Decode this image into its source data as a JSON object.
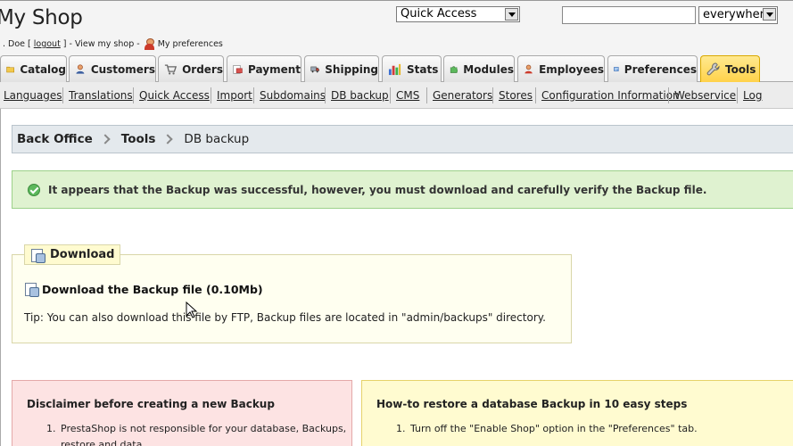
{
  "header": {
    "shop_title": "My Shop",
    "user_prefix": ". Doe [",
    "logout": "logout",
    "user_mid": "] - View my shop -",
    "preferences": "My preferences",
    "quick_access": "Quick Access",
    "search_value": "",
    "search_scope": "everywhere"
  },
  "tabs": [
    {
      "label": "Catalog",
      "icon": "folder-icon"
    },
    {
      "label": "Customers",
      "icon": "customers-icon"
    },
    {
      "label": "Orders",
      "icon": "cart-icon"
    },
    {
      "label": "Payment",
      "icon": "payment-icon"
    },
    {
      "label": "Shipping",
      "icon": "truck-icon"
    },
    {
      "label": "Stats",
      "icon": "chart-icon"
    },
    {
      "label": "Modules",
      "icon": "puzzle-icon"
    },
    {
      "label": "Employees",
      "icon": "employee-icon"
    },
    {
      "label": "Preferences",
      "icon": "preferences-icon"
    },
    {
      "label": "Tools",
      "icon": "wrench-icon",
      "active": true
    }
  ],
  "subtabs": [
    "Languages",
    "Translations",
    "Quick Access",
    "Import",
    "Subdomains",
    "DB backup",
    "CMS",
    "Generators",
    "Stores",
    "Configuration Information",
    "Webservice",
    "Log"
  ],
  "breadcrumb": [
    "Back Office",
    "Tools",
    "DB backup"
  ],
  "success_message": "It appears that the Backup was successful, however, you must download and carefully verify the Backup file.",
  "download": {
    "legend": "Download",
    "link": "Download the Backup file (0.10Mb)",
    "tip": "Tip: You can also download this file by FTP, Backup files are located in \"admin/backups\" directory."
  },
  "disclaimer": {
    "title": "Disclaimer before creating a new Backup",
    "items": [
      {
        "num": "1.",
        "text": "PrestaShop is not responsible for your database, Backups,"
      },
      {
        "num": "",
        "text": "restore and data."
      }
    ]
  },
  "restore": {
    "title": "How-to restore a database Backup in 10 easy steps",
    "items": [
      {
        "num": "1.",
        "text": "Turn off the \"Enable Shop\" option in the \"Preferences\" tab."
      }
    ]
  },
  "colors": {
    "active_tab": "#ffd24a",
    "success_bg": "#dff2d0",
    "disclaimer_bg": "#fde3e3",
    "restore_bg": "#fffbd0"
  }
}
